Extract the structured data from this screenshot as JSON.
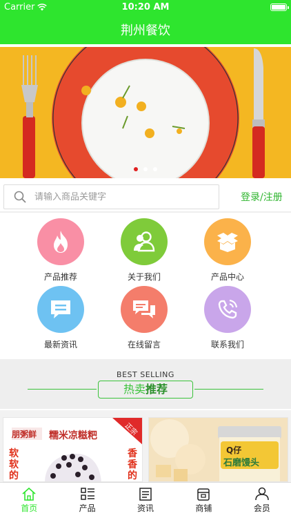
{
  "status_bar": {
    "carrier": "Carrier",
    "time": "10:20 AM"
  },
  "nav": {
    "title": "荆州餐饮"
  },
  "banner": {
    "slides": 3,
    "active_slide": 1
  },
  "search": {
    "placeholder": "请输入商品关键字",
    "login_label": "登录/注册"
  },
  "grid": [
    {
      "label": "产品推荐",
      "icon": "flame-icon",
      "color": "#f98fa5"
    },
    {
      "label": "关于我们",
      "icon": "users-icon",
      "color": "#7fcb3a"
    },
    {
      "label": "产品中心",
      "icon": "box-icon",
      "color": "#fbb24a"
    },
    {
      "label": "最新资讯",
      "icon": "message-icon",
      "color": "#6ec2f2"
    },
    {
      "label": "在线留言",
      "icon": "chat-bubbles-icon",
      "color": "#f47d6b"
    },
    {
      "label": "联系我们",
      "icon": "phone-icon",
      "color": "#c9a6ea"
    }
  ],
  "best_selling": {
    "title": "BEST SELLING",
    "pill_hot": "热卖",
    "pill_rec": "推荐"
  },
  "products": [
    {
      "name": "糯米凉糍粑",
      "brand": "朋粥鲜",
      "left_text": "软软的",
      "right_text": "香香的",
      "badge": "正宗"
    },
    {
      "name": "石磨馒头",
      "brand": "Q仔"
    }
  ],
  "tabs": [
    {
      "label": "首页",
      "icon": "home-icon",
      "active": true
    },
    {
      "label": "产品",
      "icon": "grid-list-icon",
      "active": false
    },
    {
      "label": "资讯",
      "icon": "news-icon",
      "active": false
    },
    {
      "label": "商铺",
      "icon": "shop-icon",
      "active": false
    },
    {
      "label": "会员",
      "icon": "person-icon",
      "active": false
    }
  ],
  "colors": {
    "brand_green": "#2ee52e",
    "link_green": "#2fb52f",
    "pill_green": "#39c239"
  }
}
